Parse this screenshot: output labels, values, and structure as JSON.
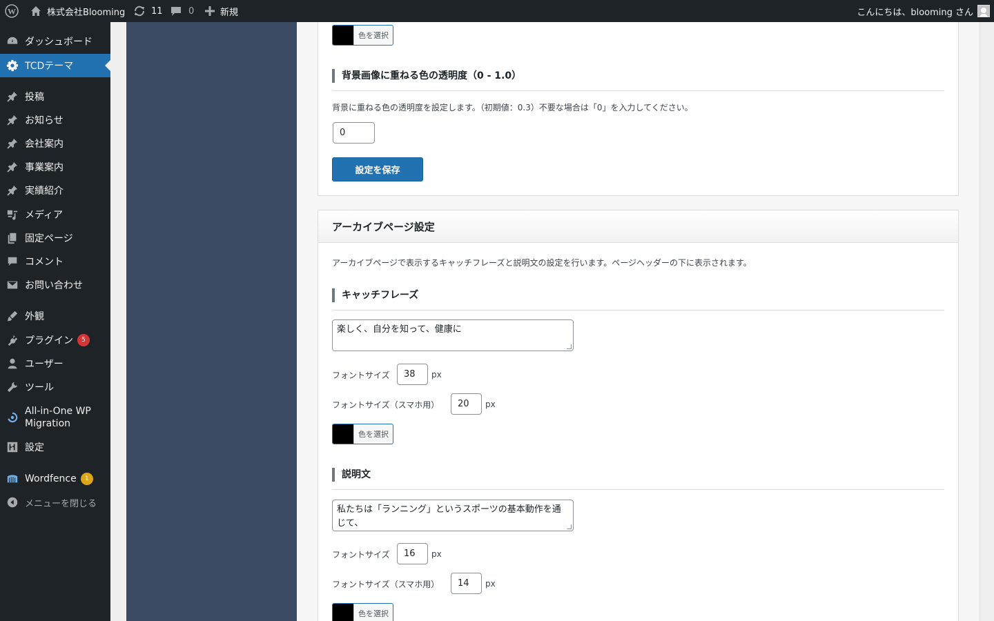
{
  "adminbar": {
    "site_name": "株式会社Blooming",
    "updates_count": "11",
    "comments_count": "0",
    "new_label": "新規",
    "greeting": "こんにちは、blooming さん"
  },
  "sidebar": {
    "items": [
      {
        "label": "ダッシュボード",
        "icon": "dashboard-icon"
      },
      {
        "label": "TCDテーマ",
        "icon": "gear-icon"
      },
      {
        "label": "投稿",
        "icon": "pin-icon"
      },
      {
        "label": "お知らせ",
        "icon": "pin-icon"
      },
      {
        "label": "会社案内",
        "icon": "pin-icon"
      },
      {
        "label": "事業案内",
        "icon": "pin-icon"
      },
      {
        "label": "実績紹介",
        "icon": "pin-icon"
      },
      {
        "label": "メディア",
        "icon": "media-icon"
      },
      {
        "label": "固定ページ",
        "icon": "pages-icon"
      },
      {
        "label": "コメント",
        "icon": "comment-icon"
      },
      {
        "label": "お問い合わせ",
        "icon": "mail-icon"
      },
      {
        "label": "外観",
        "icon": "brush-icon"
      },
      {
        "label": "プラグイン",
        "icon": "plugin-icon",
        "badge": "5"
      },
      {
        "label": "ユーザー",
        "icon": "user-icon"
      },
      {
        "label": "ツール",
        "icon": "wrench-icon"
      },
      {
        "label": "All-in-One WP Migration",
        "icon": "migration-icon"
      },
      {
        "label": "設定",
        "icon": "settings-icon"
      },
      {
        "label": "Wordfence",
        "icon": "wordfence-icon",
        "badge": "1"
      },
      {
        "label": "メニューを閉じる",
        "icon": "collapse-icon"
      }
    ]
  },
  "section1": {
    "color_button": "色を選択",
    "opacity_heading": "背景画像に重ねる色の透明度（0 - 1.0）",
    "opacity_desc": "背景に重ねる色の透明度を設定します。（初期値：0.3）不要な場合は「0」を入力してください。",
    "opacity_value": "0",
    "save_label": "設定を保存"
  },
  "archive": {
    "title": "アーカイブページ設定",
    "desc": "アーカイブページで表示するキャッチフレーズと説明文の設定を行います。ページヘッダーの下に表示されます。",
    "catch": {
      "heading": "キャッチフレーズ",
      "text": "楽しく、自分を知って、健康に",
      "font_label": "フォントサイズ",
      "font_value": "38",
      "font_sp_label": "フォントサイズ（スマホ用）",
      "font_sp_value": "20",
      "unit": "px",
      "color_button": "色を選択"
    },
    "description": {
      "heading": "説明文",
      "text": "私たちは「ランニング」というスポーツの基本動作を通じて、",
      "font_label": "フォントサイズ",
      "font_value": "16",
      "font_sp_label": "フォントサイズ（スマホ用）",
      "font_sp_value": "14",
      "unit": "px",
      "color_button": "色を選択"
    }
  }
}
